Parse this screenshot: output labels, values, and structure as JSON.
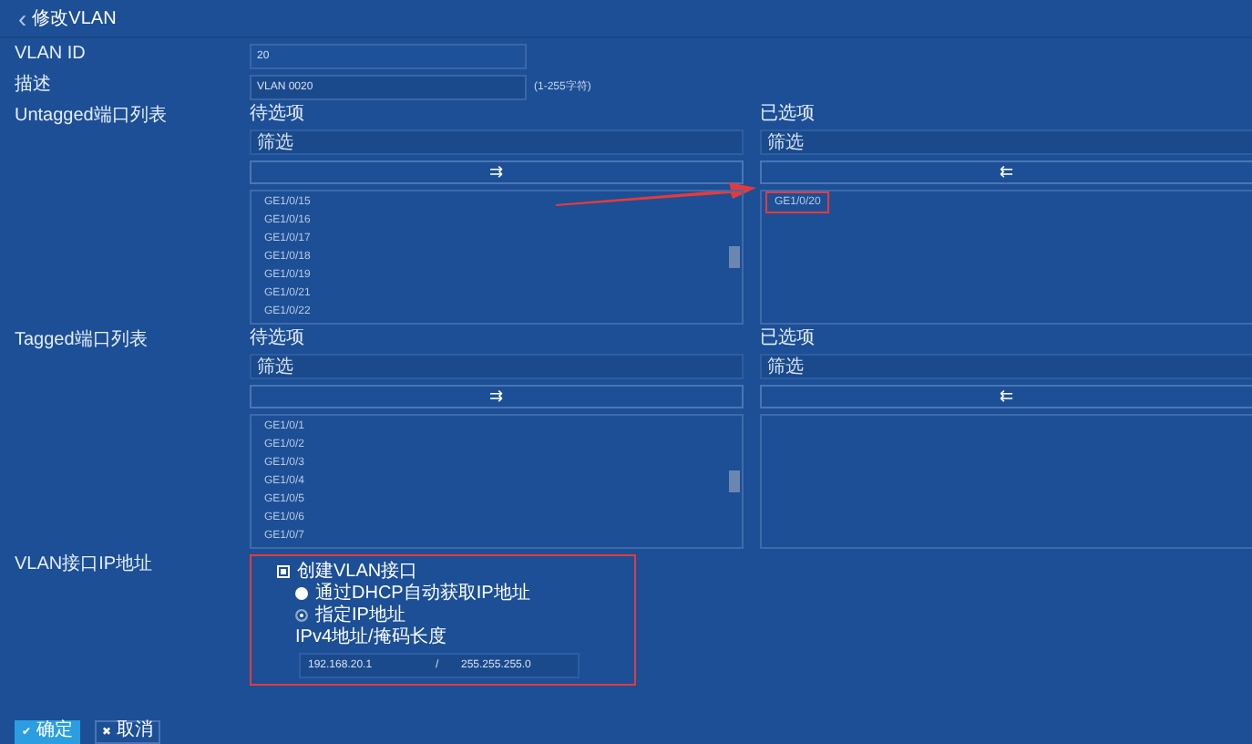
{
  "header": {
    "back": "‹",
    "title": "修改VLAN"
  },
  "vlan_id": {
    "label": "VLAN ID",
    "value": "20"
  },
  "description": {
    "label": "描述",
    "value": "VLAN 0020",
    "hint": "(1-255字符)"
  },
  "port_lists": [
    {
      "label": "Untagged端口列表",
      "available": {
        "title": "待选项",
        "placeholder": "筛选",
        "move": "⇉",
        "items": [
          "GE1/0/15",
          "GE1/0/16",
          "GE1/0/17",
          "GE1/0/18",
          "GE1/0/19",
          "GE1/0/21",
          "GE1/0/22"
        ]
      },
      "chosen": {
        "title": "已选项",
        "placeholder": "筛选",
        "move": "⇇",
        "items": [
          "GE1/0/20"
        ]
      },
      "annotated": true
    },
    {
      "label": "Tagged端口列表",
      "available": {
        "title": "待选项",
        "placeholder": "筛选",
        "move": "⇉",
        "items": [
          "GE1/0/1",
          "GE1/0/2",
          "GE1/0/3",
          "GE1/0/4",
          "GE1/0/5",
          "GE1/0/6",
          "GE1/0/7"
        ]
      },
      "chosen": {
        "title": "已选项",
        "placeholder": "筛选",
        "move": "⇇"
      },
      "annotated": false
    }
  ],
  "ip_section": {
    "label": "VLAN接口IP地址",
    "create": {
      "label": "创建VLAN接口",
      "checked": true
    },
    "modes": [
      {
        "label": "通过DHCP自动获取IP地址",
        "selected": false
      },
      {
        "label": "指定IP地址",
        "selected": true
      }
    ],
    "address_label": "IPv4地址/掩码长度",
    "address": "192.168.20.1",
    "separator": "/",
    "mask": "255.255.255.0"
  },
  "buttons": [
    {
      "kind": "primary",
      "icon": "✔",
      "label": "确定"
    },
    {
      "kind": "secondary",
      "icon": "✖",
      "label": "取消"
    }
  ]
}
